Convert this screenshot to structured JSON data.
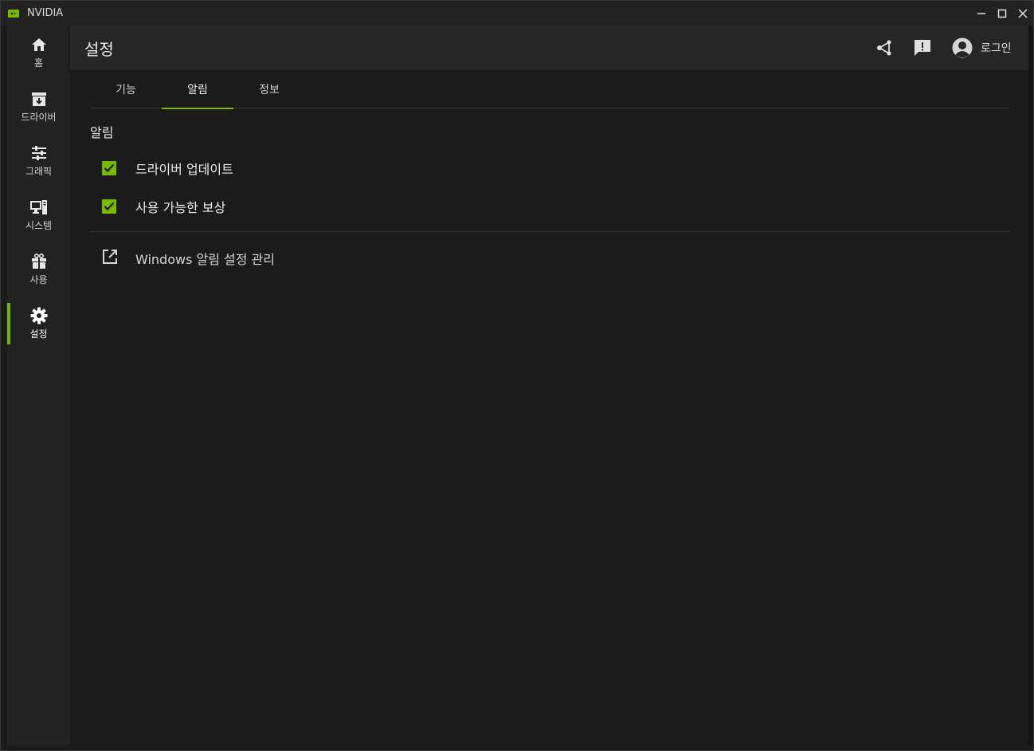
{
  "window": {
    "title": "NVIDIA",
    "accent_color": "#76b900"
  },
  "sidebar": {
    "items": [
      {
        "label": "홈",
        "icon": "home-icon",
        "active": false
      },
      {
        "label": "드라이버",
        "icon": "driver-download-icon",
        "active": false
      },
      {
        "label": "그래픽",
        "icon": "sliders-icon",
        "active": false
      },
      {
        "label": "시스템",
        "icon": "system-monitor-icon",
        "active": false
      },
      {
        "label": "사용",
        "icon": "gift-icon",
        "active": false
      },
      {
        "label": "설정",
        "icon": "gear-icon",
        "active": true
      }
    ]
  },
  "header": {
    "title": "설정",
    "share_icon": "share-icon",
    "feedback_icon": "feedback-icon",
    "login_label": "로그인"
  },
  "tabs": [
    {
      "label": "기능",
      "active": false
    },
    {
      "label": "알림",
      "active": true
    },
    {
      "label": "정보",
      "active": false
    }
  ],
  "notifications": {
    "section_title": "알림",
    "options": [
      {
        "label": "드라이버 업데이트",
        "checked": true
      },
      {
        "label": "사용 가능한 보상",
        "checked": true
      }
    ],
    "manage_link": "Windows 알림 설정 관리"
  }
}
